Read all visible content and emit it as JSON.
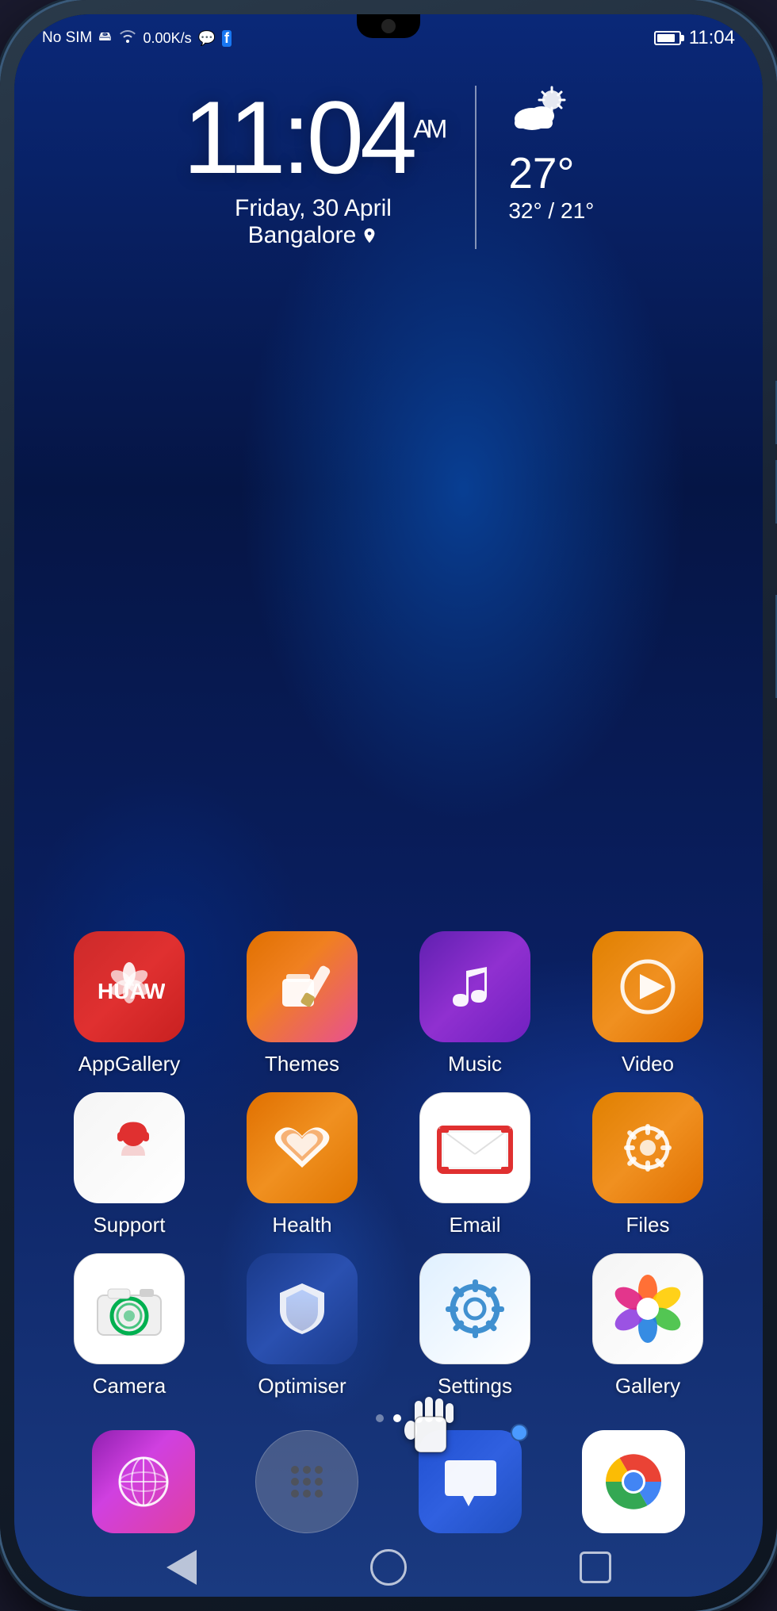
{
  "phone": {
    "status_bar": {
      "no_sim": "No SIM",
      "data_speed": "0.00K/s",
      "time": "11:04"
    },
    "clock": {
      "time": "11:04",
      "am_pm": "AM",
      "date": "Friday, 30 April",
      "location": "Bangalore"
    },
    "weather": {
      "current_temp": "27°",
      "high_low": "32° / 21°"
    },
    "apps": {
      "row1": [
        {
          "id": "appgallery",
          "label": "AppGallery",
          "icon_type": "appgallery"
        },
        {
          "id": "themes",
          "label": "Themes",
          "icon_type": "themes"
        },
        {
          "id": "music",
          "label": "Music",
          "icon_type": "music"
        },
        {
          "id": "video",
          "label": "Video",
          "icon_type": "video"
        }
      ],
      "row2": [
        {
          "id": "support",
          "label": "Support",
          "icon_type": "support"
        },
        {
          "id": "health",
          "label": "Health",
          "icon_type": "health"
        },
        {
          "id": "email",
          "label": "Email",
          "icon_type": "email"
        },
        {
          "id": "files",
          "label": "Files",
          "icon_type": "files"
        }
      ],
      "row3": [
        {
          "id": "camera",
          "label": "Camera",
          "icon_type": "camera"
        },
        {
          "id": "optimiser",
          "label": "Optimiser",
          "icon_type": "optimiser"
        },
        {
          "id": "settings",
          "label": "Settings",
          "icon_type": "settings"
        },
        {
          "id": "gallery",
          "label": "Gallery",
          "icon_type": "gallery"
        }
      ]
    },
    "dock": [
      {
        "id": "browser",
        "icon_type": "browser"
      },
      {
        "id": "allapps",
        "icon_type": "allapps"
      },
      {
        "id": "messages",
        "icon_type": "messages"
      },
      {
        "id": "chrome",
        "icon_type": "chrome"
      }
    ],
    "nav": {
      "back_label": "back",
      "home_label": "home",
      "recents_label": "recents"
    },
    "page_dots": {
      "total": 2,
      "active": 0
    }
  }
}
